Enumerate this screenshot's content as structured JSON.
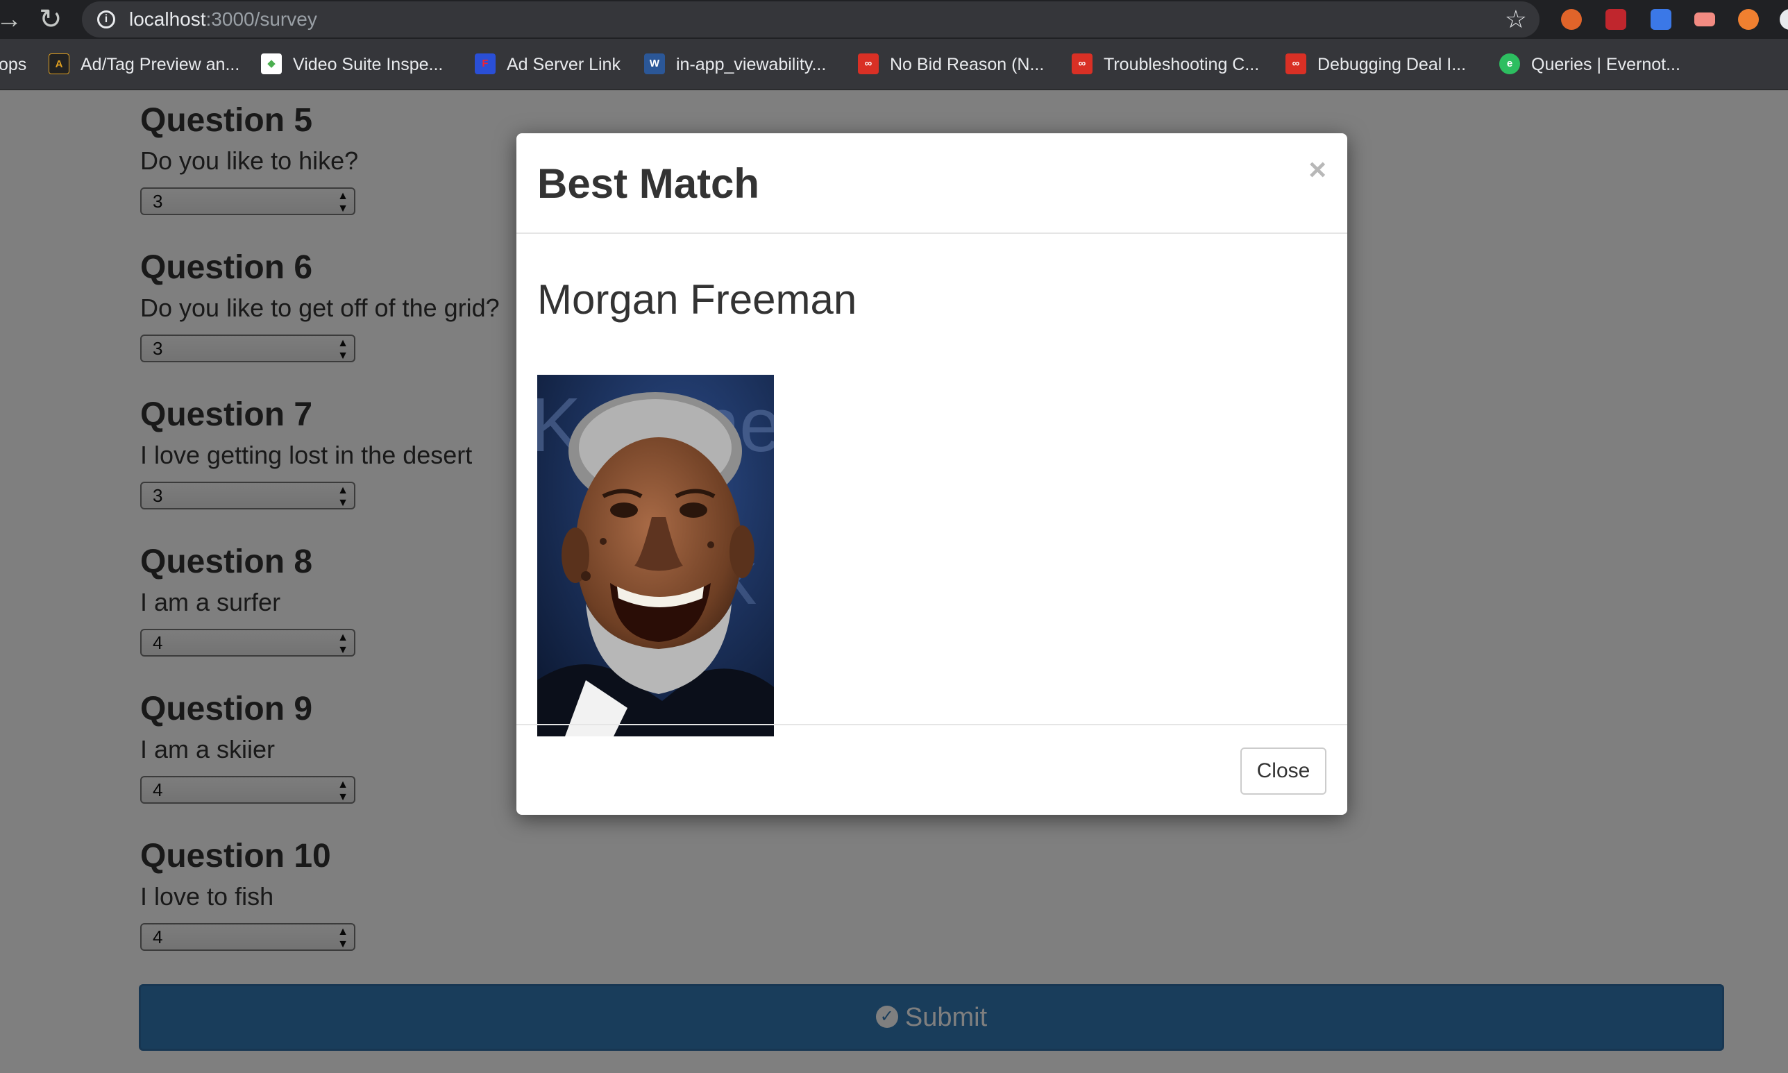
{
  "browser": {
    "url_host": "localhost",
    "url_path": ":3000/survey",
    "bookmarks": [
      {
        "label": "ops",
        "favicon": "none",
        "color": ""
      },
      {
        "label": "Ad/Tag Preview an...",
        "favicon": "adtag-icon",
        "color": "#e0a020"
      },
      {
        "label": "Video Suite Inspe...",
        "favicon": "video-suite-icon",
        "color": "#4caf50"
      },
      {
        "label": "Ad Server Link",
        "favicon": "ad-server-icon",
        "color": "#2a4fd6"
      },
      {
        "label": "in-app_viewability...",
        "favicon": "word-doc-icon",
        "color": "#2b5797"
      },
      {
        "label": "No Bid Reason (N...",
        "favicon": "link-icon",
        "color": "#d93025"
      },
      {
        "label": "Troubleshooting C...",
        "favicon": "link-icon",
        "color": "#d93025"
      },
      {
        "label": "Debugging Deal I...",
        "favicon": "link-icon",
        "color": "#d93025"
      },
      {
        "label": "Queries | Evernot...",
        "favicon": "evernote-icon",
        "color": "#2dbe60"
      }
    ]
  },
  "survey": {
    "questions": [
      {
        "title": "Question 5",
        "text": "Do you like to hike?",
        "value": "3"
      },
      {
        "title": "Question 6",
        "text": "Do you like to get off of the grid?",
        "value": "3"
      },
      {
        "title": "Question 7",
        "text": "I love getting lost in the desert",
        "value": "3"
      },
      {
        "title": "Question 8",
        "text": "I am a surfer",
        "value": "4"
      },
      {
        "title": "Question 9",
        "text": "I am a skiier",
        "value": "4"
      },
      {
        "title": "Question 10",
        "text": "I love to fish",
        "value": "4"
      }
    ],
    "submit_label": "Submit"
  },
  "modal": {
    "title": "Best Match",
    "close_x": "×",
    "match_name": "Morgan Freeman",
    "close_label": "Close"
  },
  "colors": {
    "primary": "#337ab7",
    "backdrop": "rgba(0,0,0,0.5)"
  }
}
